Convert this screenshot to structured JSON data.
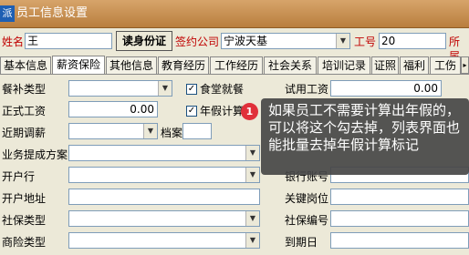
{
  "window": {
    "title": "员工信息设置",
    "logo": "派"
  },
  "header": {
    "name_label": "姓名",
    "name_value": "王",
    "read_id_button": "读身份证",
    "company_label": "签约公司",
    "company_value": "宁波天基",
    "emp_no_label": "工号",
    "emp_no_value": "20",
    "dept_label": "所属"
  },
  "tabs": [
    "基本信息",
    "薪资保险",
    "其他信息",
    "教育经历",
    "工作经历",
    "社会关系",
    "培训记录",
    "证照",
    "福利",
    "工伤"
  ],
  "form": {
    "meal_type_label": "餐补类型",
    "canteen_label": "食堂就餐",
    "trial_wage_label": "试用工资",
    "trial_wage_value": "0.00",
    "formal_wage_label": "正式工资",
    "formal_wage_value": "0.00",
    "annual_leave_label": "年假计算",
    "near_adjust_label": "近期调薪",
    "archive_label": "档案",
    "commission_label": "业务提成方案",
    "bank_label": "开户行",
    "bank_account_label": "银行账号",
    "bank_address_label": "开户地址",
    "key_post_label": "关键岗位",
    "social_type_label": "社保类型",
    "social_no_label": "社保编号",
    "commercial_type_label": "商险类型",
    "expiry_label": "到期日"
  },
  "tooltip": {
    "badge": "1",
    "text": "如果员工不需要计算出年假的，可以将这个勾去掉，列表界面也能批量去掉年假计算标记"
  },
  "colors": {
    "title_bar": "#c58b4c",
    "label_red": "#c00000",
    "tooltip_bg": "#464646",
    "badge": "#e0303a"
  }
}
